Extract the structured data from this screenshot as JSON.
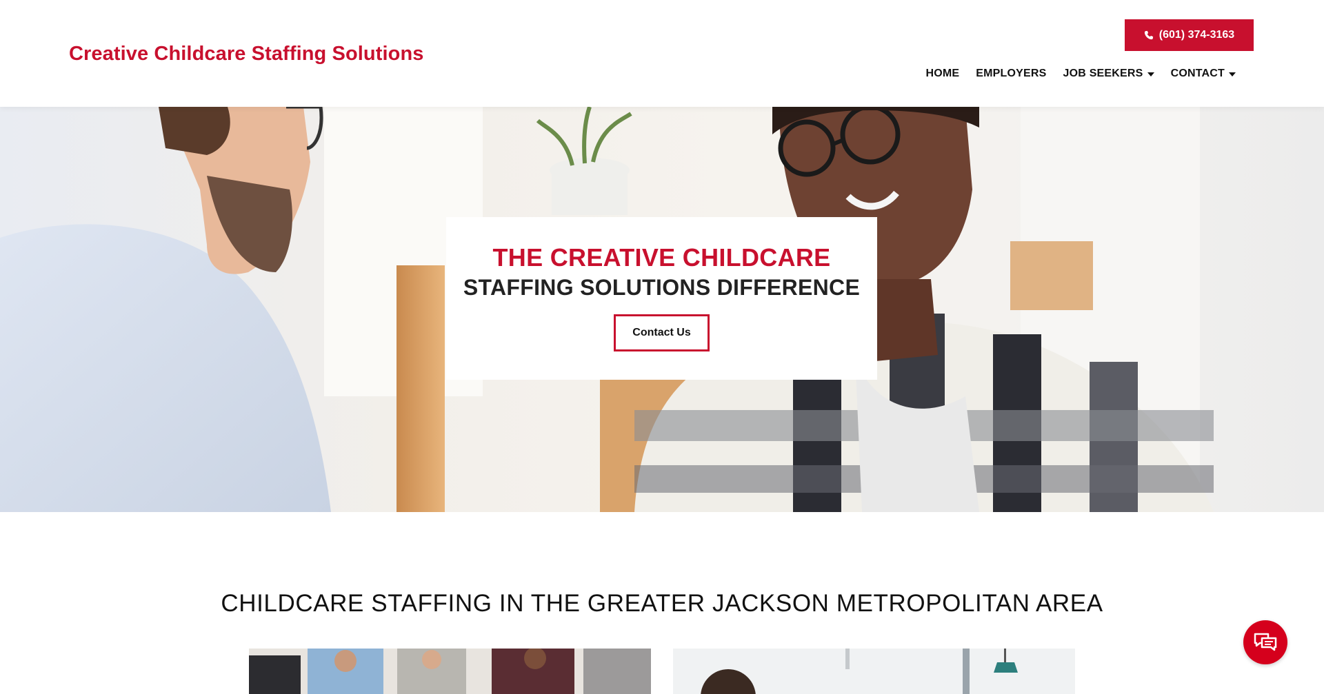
{
  "header": {
    "brand": "Creative Childcare Staffing Solutions",
    "phone_label": "(601) 374-3163",
    "nav": [
      {
        "label": "HOME",
        "has_dropdown": false
      },
      {
        "label": "EMPLOYERS",
        "has_dropdown": false
      },
      {
        "label": "JOB SEEKERS",
        "has_dropdown": true
      },
      {
        "label": "CONTACT",
        "has_dropdown": true
      }
    ]
  },
  "hero": {
    "title_line_1": "THE CREATIVE CHILDCARE",
    "title_line_2": "STAFFING SOLUTIONS DIFFERENCE",
    "cta_label": "Contact Us"
  },
  "section": {
    "title": "CHILDCARE STAFFING IN THE GREATER JACKSON METROPOLITAN AREA"
  },
  "colors": {
    "brand_red": "#c8102e",
    "chat_red": "#d5001c",
    "text_dark": "#111111"
  },
  "icons": {
    "phone": "phone-icon",
    "caret": "chevron-down-icon",
    "chat": "chat-icon"
  }
}
